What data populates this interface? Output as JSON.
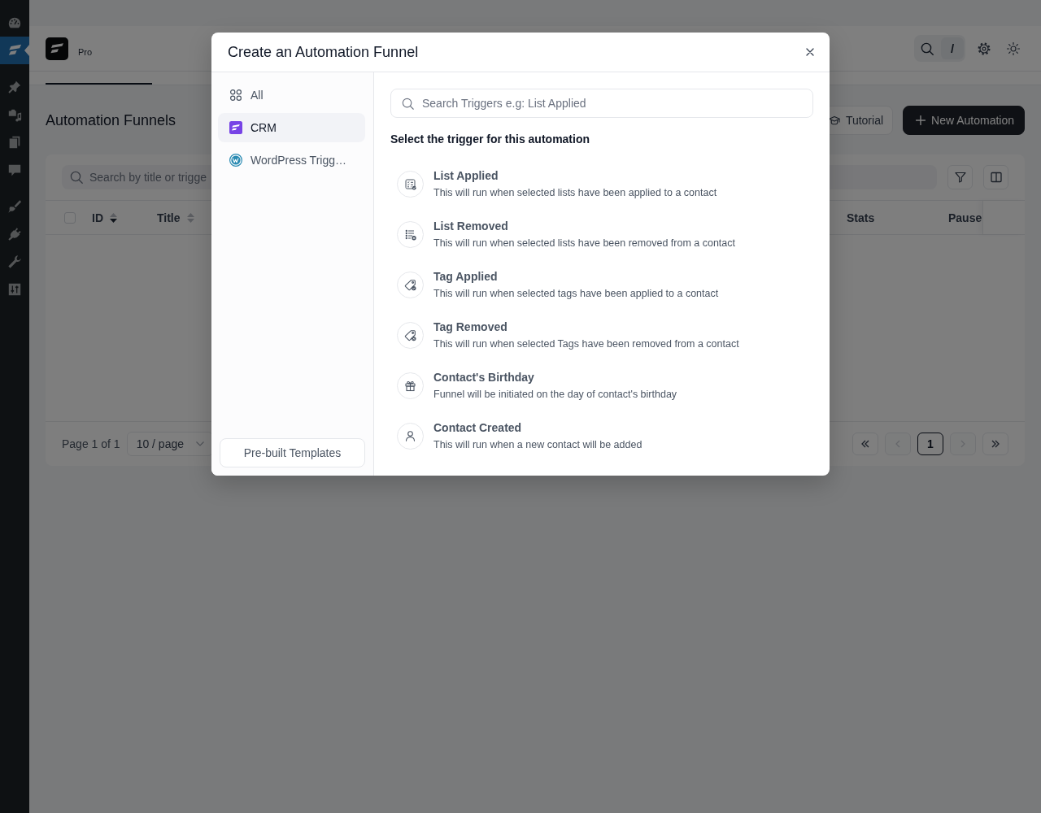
{
  "admin_menu": [
    {
      "selected": false
    },
    {
      "selected": true
    },
    {
      "selected": false
    },
    {
      "selected": false
    },
    {
      "selected": false
    },
    {
      "selected": false
    },
    {
      "selected": false
    },
    {
      "selected": false
    },
    {
      "selected": false
    },
    {
      "selected": false
    }
  ],
  "header": {
    "edition": "Pro",
    "search_shortcut": "/"
  },
  "page": {
    "title": "Automation Funnels",
    "actions": [
      {
        "label": "Tutorial",
        "kind": "secondary"
      },
      {
        "label": "New Automation",
        "kind": "primary"
      }
    ]
  },
  "table": {
    "search": {
      "placeholder": "Search by title or trigge"
    },
    "select_all": {
      "checked": false
    },
    "columns": [
      {
        "label": "ID",
        "sortable": true,
        "sorted_descending": true
      },
      {
        "label": "Title",
        "sortable": true,
        "sorted_descending": false
      },
      {
        "label": "Stats"
      },
      {
        "label": "Pause"
      }
    ],
    "footer": {
      "page_info": "Page 1 of 1",
      "page_size": "10 / page",
      "pager": {
        "first": {
          "disabled": false
        },
        "previous": {
          "disabled": true
        },
        "pages": [
          {
            "label": "1",
            "selected": true
          }
        ],
        "next": {
          "disabled": true
        },
        "last": {
          "disabled": false
        }
      }
    }
  },
  "modal": {
    "title": "Create an Automation Funnel",
    "categories": [
      {
        "label": "All",
        "kind": "all",
        "selected": false
      },
      {
        "label": "CRM",
        "kind": "crm",
        "selected": true
      },
      {
        "label": "WordPress Trigg…",
        "kind": "wordpress",
        "selected": false
      }
    ],
    "templates_button": "Pre-built Templates",
    "search": {
      "placeholder": "Search Triggers e.g: List Applied"
    },
    "prompt": "Select the trigger for this automation",
    "triggers": [
      {
        "kind": "list_applied",
        "title": "List Applied",
        "description": "This will run when selected lists have been applied to a contact"
      },
      {
        "kind": "list_removed",
        "title": "List Removed",
        "description": "This will run when selected lists have been removed from a contact"
      },
      {
        "kind": "tag_applied",
        "title": "Tag Applied",
        "description": "This will run when selected tags have been applied to a contact"
      },
      {
        "kind": "tag_removed",
        "title": "Tag Removed",
        "description": "This will run when selected Tags have been removed from a contact"
      },
      {
        "kind": "birthday",
        "title": "Contact's Birthday",
        "description": "Funnel will be initiated on the day of contact's birthday"
      },
      {
        "kind": "contact_created",
        "title": "Contact Created",
        "description": "This will run when a new contact will be added"
      }
    ]
  }
}
